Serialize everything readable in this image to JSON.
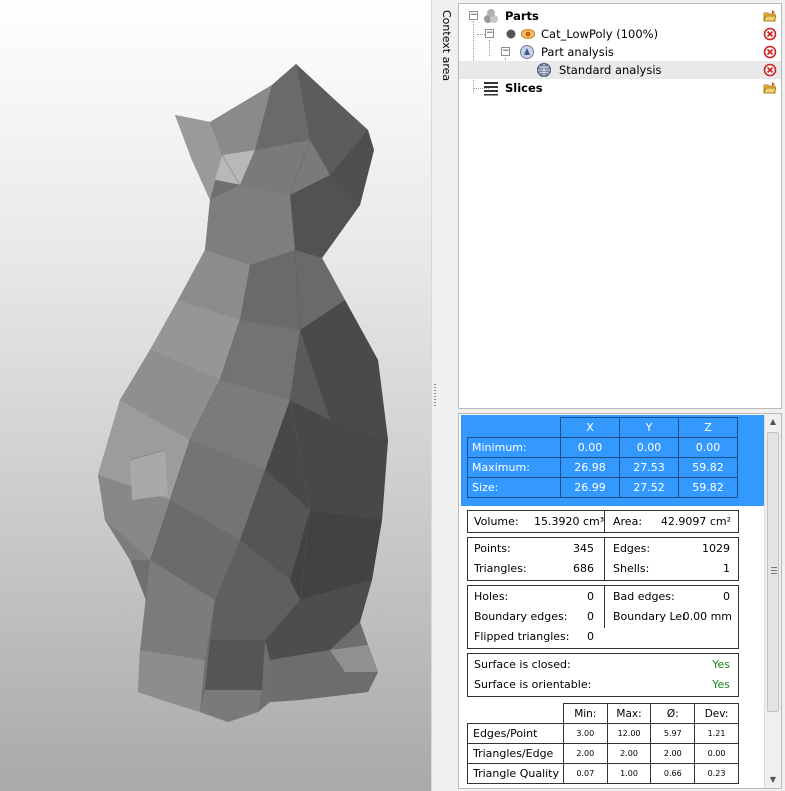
{
  "context_area": {
    "label": "Context area"
  },
  "tree": {
    "items": [
      {
        "label": "Parts",
        "bold": true,
        "icon": "parts-icon",
        "action_icon": "open-folder-icon"
      },
      {
        "label": "Cat_LowPoly (100%)",
        "bold": false,
        "icon": "part-eye-icon",
        "action_icon": "remove-icon"
      },
      {
        "label": "Part analysis",
        "bold": false,
        "icon": "analysis-icon",
        "action_icon": "remove-icon"
      },
      {
        "label": "Standard analysis",
        "bold": false,
        "icon": "globe-icon",
        "action_icon": "remove-icon",
        "selected": true
      },
      {
        "label": "Slices",
        "bold": true,
        "icon": "slices-icon",
        "action_icon": "open-folder-icon"
      }
    ]
  },
  "analysis": {
    "bbox": {
      "headers": [
        "X",
        "Y",
        "Z"
      ],
      "rows": [
        {
          "label": "Minimum:",
          "values": [
            "0.00",
            "0.00",
            "0.00"
          ]
        },
        {
          "label": "Maximum:",
          "values": [
            "26.98",
            "27.53",
            "59.82"
          ]
        },
        {
          "label": "Size:",
          "values": [
            "26.99",
            "27.52",
            "59.82"
          ]
        }
      ]
    },
    "volume": {
      "label": "Volume:",
      "value": "15.3920 cm³"
    },
    "area": {
      "label": "Area:",
      "value": "42.9097 cm²"
    },
    "points": {
      "label": "Points:",
      "value": "345"
    },
    "edges": {
      "label": "Edges:",
      "value": "1029"
    },
    "triangles": {
      "label": "Triangles:",
      "value": "686"
    },
    "shells": {
      "label": "Shells:",
      "value": "1"
    },
    "holes": {
      "label": "Holes:",
      "value": "0"
    },
    "bad_edges": {
      "label": "Bad edges:",
      "value": "0"
    },
    "boundary_edges": {
      "label": "Boundary edges:",
      "value": "0"
    },
    "boundary_length": {
      "label": "Boundary Leng",
      "value": "0.00 mm"
    },
    "flipped_triangles": {
      "label": "Flipped triangles:",
      "value": "0"
    },
    "surface_closed": {
      "label": "Surface is closed:",
      "value": "Yes"
    },
    "surface_orientable": {
      "label": "Surface is orientable:",
      "value": "Yes"
    },
    "stats": {
      "headers": [
        "Min:",
        "Max:",
        "Ø:",
        "Dev:"
      ],
      "rows": [
        {
          "label": "Edges/Point",
          "values": [
            "3.00",
            "12.00",
            "5.97",
            "1.21"
          ]
        },
        {
          "label": "Triangles/Edge",
          "values": [
            "2.00",
            "2.00",
            "2.00",
            "0.00"
          ]
        },
        {
          "label": "Triangle Quality",
          "values": [
            "0.07",
            "1.00",
            "0.66",
            "0.23"
          ]
        }
      ]
    }
  },
  "colors": {
    "selection_blue": "#3399ff",
    "ok_green": "#1a8a1a",
    "remove_red": "#cc2222"
  }
}
